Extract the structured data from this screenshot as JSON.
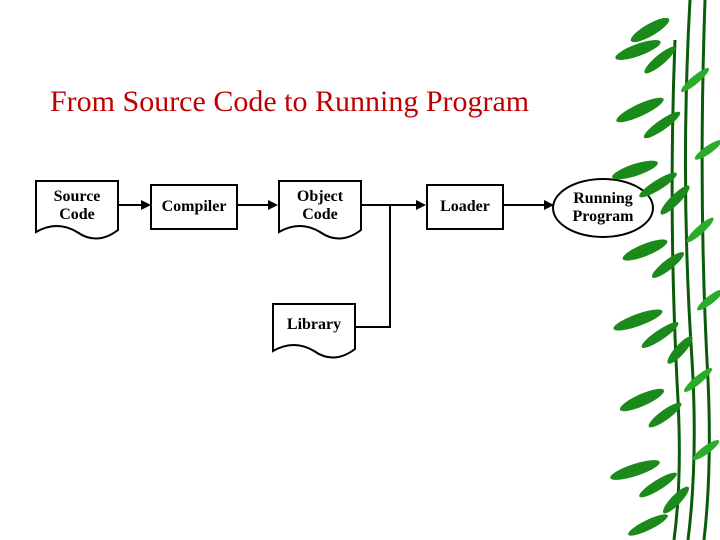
{
  "title": "From Source Code to Running Program",
  "nodes": {
    "source": "Source\nCode",
    "compiler": "Compiler",
    "object": "Object\nCode",
    "library": "Library",
    "loader": "Loader",
    "running": "Running\nProgram"
  },
  "chart_data": {
    "type": "flow-diagram",
    "title": "From Source Code to Running Program",
    "nodes": [
      {
        "id": "source",
        "label": "Source Code",
        "shape": "document"
      },
      {
        "id": "compiler",
        "label": "Compiler",
        "shape": "rect"
      },
      {
        "id": "object",
        "label": "Object Code",
        "shape": "document"
      },
      {
        "id": "library",
        "label": "Library",
        "shape": "document"
      },
      {
        "id": "loader",
        "label": "Loader",
        "shape": "rect"
      },
      {
        "id": "running",
        "label": "Running Program",
        "shape": "ellipse"
      }
    ],
    "edges": [
      {
        "from": "source",
        "to": "compiler"
      },
      {
        "from": "compiler",
        "to": "object"
      },
      {
        "from": "object",
        "to": "loader"
      },
      {
        "from": "library",
        "to": "loader"
      },
      {
        "from": "loader",
        "to": "running"
      }
    ]
  }
}
